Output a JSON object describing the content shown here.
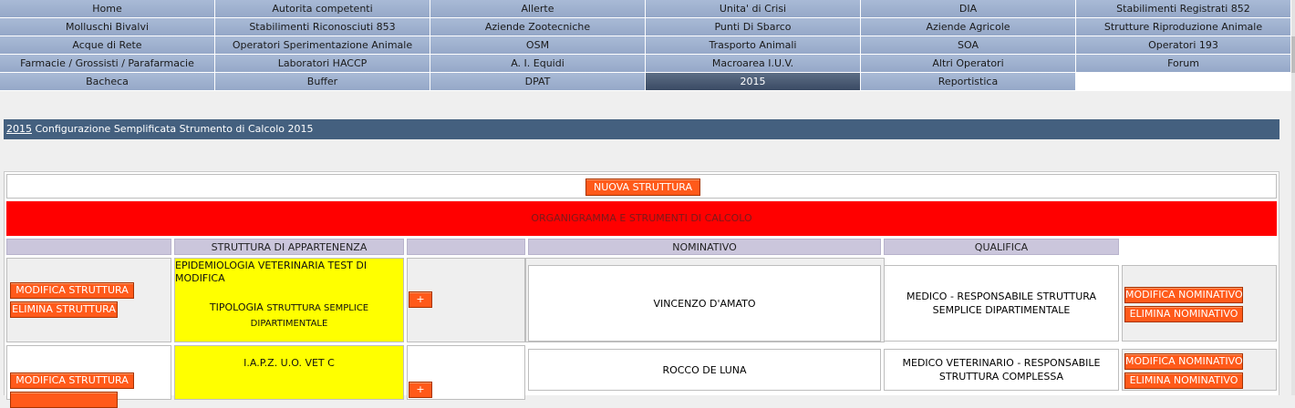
{
  "menu": {
    "rows": [
      [
        "Home",
        "Autorita competenti",
        "Allerte",
        "Unita' di Crisi",
        "DIA",
        "Stabilimenti Registrati 852"
      ],
      [
        "Molluschi Bivalvi",
        "Stabilimenti Riconosciuti 853",
        "Aziende Zootecniche",
        "Punti Di Sbarco",
        "Aziende Agricole",
        "Strutture Riproduzione Animale"
      ],
      [
        "Acque di Rete",
        "Operatori Sperimentazione Animale",
        "OSM",
        "Trasporto Animali",
        "SOA",
        "Operatori 193"
      ],
      [
        "Farmacie / Grossisti / Parafarmacie",
        "Laboratori HACCP",
        "A. I. Equidi",
        "Macroarea I.U.V.",
        "Altri Operatori",
        "Forum"
      ],
      [
        "Bacheca",
        "Buffer",
        "DPAT",
        "2015",
        "Reportistica"
      ]
    ],
    "active": "2015"
  },
  "title_bar": {
    "link": "2015",
    "text": " Configurazione Semplificata Strumento di Calcolo 2015"
  },
  "buttons": {
    "nuova_struttura": "NUOVA STRUTTURA",
    "modifica_struttura": "MODIFICA STRUTTURA",
    "elimina_struttura": "ELIMINA STRUTTURA",
    "modifica_nominativo": "MODIFICA NOMINATIVO",
    "elimina_nominativo": "ELIMINA NOMINATIVO",
    "plus": "+"
  },
  "banner": "ORGANIGRAMMA E STRUMENTI DI CALCOLO",
  "headers": {
    "struttura": "STRUTTURA DI APPARTENENZA",
    "nominativo": "NOMINATIVO",
    "qualifica": "QUALIFICA"
  },
  "rows": [
    {
      "struttura": "EPIDEMIOLOGIA VETERINARIA TEST DI MODIFICA",
      "tipologia_label": "TIPOLOGIA",
      "tipologia_value": "STRUTTURA SEMPLICE DIPARTIMENTALE",
      "nominativo": "VINCENZO D'AMATO",
      "qualifica": "MEDICO - RESPONSABILE STRUTTURA SEMPLICE DIPARTIMENTALE"
    },
    {
      "struttura": "I.A.P.Z. U.O. VET C",
      "nominativo": "ROCCO DE LUNA",
      "qualifica": "MEDICO VETERINARIO - RESPONSABILE STRUTTURA COMPLESSA"
    }
  ]
}
